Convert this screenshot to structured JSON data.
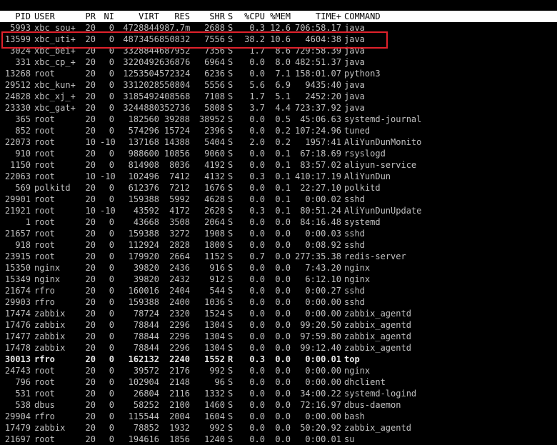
{
  "header": {
    "pid": "PID",
    "user": "USER",
    "pr": "PR",
    "ni": "NI",
    "virt": "VIRT",
    "res": "RES",
    "shr": "SHR",
    "s": "S",
    "cpu": "%CPU",
    "mem": "%MEM",
    "time": "TIME+",
    "command": "COMMAND"
  },
  "highlight_color": "#e0212b",
  "processes": [
    {
      "pid": "5993",
      "user": "xbc_sou+",
      "pr": "20",
      "ni": "0",
      "virt": "4728844",
      "res": "987.7m",
      "shr": "2688",
      "s": "S",
      "cpu": "0.3",
      "mem": "12.6",
      "time": "706:58.17",
      "command": "java"
    },
    {
      "pid": "13599",
      "user": "xbc_uti+",
      "pr": "20",
      "ni": "0",
      "virt": "4873456",
      "res": "850832",
      "shr": "7556",
      "s": "S",
      "cpu": "38.2",
      "mem": "10.6",
      "time": "4604:38",
      "command": "java",
      "highlighted": true
    },
    {
      "pid": "3024",
      "user": "xbc_bei+",
      "pr": "20",
      "ni": "0",
      "virt": "3328844",
      "res": "687952",
      "shr": "7356",
      "s": "S",
      "cpu": "1.7",
      "mem": "8.6",
      "time": "729:58.39",
      "command": "java"
    },
    {
      "pid": "331",
      "user": "xbc_cp_+",
      "pr": "20",
      "ni": "0",
      "virt": "3220492",
      "res": "636876",
      "shr": "6964",
      "s": "S",
      "cpu": "0.0",
      "mem": "8.0",
      "time": "482:51.37",
      "command": "java"
    },
    {
      "pid": "13268",
      "user": "root",
      "pr": "20",
      "ni": "0",
      "virt": "1253504",
      "res": "572324",
      "shr": "6236",
      "s": "S",
      "cpu": "0.0",
      "mem": "7.1",
      "time": "158:01.07",
      "command": "python3"
    },
    {
      "pid": "29512",
      "user": "xbc_kun+",
      "pr": "20",
      "ni": "0",
      "virt": "3312028",
      "res": "550804",
      "shr": "5556",
      "s": "S",
      "cpu": "5.6",
      "mem": "6.9",
      "time": "9435:40",
      "command": "java"
    },
    {
      "pid": "24828",
      "user": "xbc_xj_+",
      "pr": "20",
      "ni": "0",
      "virt": "3185492",
      "res": "408568",
      "shr": "7108",
      "s": "S",
      "cpu": "1.7",
      "mem": "5.1",
      "time": "2452:20",
      "command": "java"
    },
    {
      "pid": "23330",
      "user": "xbc_gat+",
      "pr": "20",
      "ni": "0",
      "virt": "3244880",
      "res": "352736",
      "shr": "5808",
      "s": "S",
      "cpu": "3.7",
      "mem": "4.4",
      "time": "723:37.92",
      "command": "java"
    },
    {
      "pid": "365",
      "user": "root",
      "pr": "20",
      "ni": "0",
      "virt": "182560",
      "res": "39288",
      "shr": "38952",
      "s": "S",
      "cpu": "0.0",
      "mem": "0.5",
      "time": "45:06.63",
      "command": "systemd-journal"
    },
    {
      "pid": "852",
      "user": "root",
      "pr": "20",
      "ni": "0",
      "virt": "574296",
      "res": "15724",
      "shr": "2396",
      "s": "S",
      "cpu": "0.0",
      "mem": "0.2",
      "time": "107:24.96",
      "command": "tuned"
    },
    {
      "pid": "22073",
      "user": "root",
      "pr": "10",
      "ni": "-10",
      "virt": "137168",
      "res": "14388",
      "shr": "5404",
      "s": "S",
      "cpu": "2.0",
      "mem": "0.2",
      "time": "1957:41",
      "command": "AliYunDunMonito"
    },
    {
      "pid": "910",
      "user": "root",
      "pr": "20",
      "ni": "0",
      "virt": "988600",
      "res": "10856",
      "shr": "9060",
      "s": "S",
      "cpu": "0.0",
      "mem": "0.1",
      "time": "67:18.69",
      "command": "rsyslogd"
    },
    {
      "pid": "1150",
      "user": "root",
      "pr": "20",
      "ni": "0",
      "virt": "814908",
      "res": "8036",
      "shr": "4192",
      "s": "S",
      "cpu": "0.0",
      "mem": "0.1",
      "time": "83:57.02",
      "command": "aliyun-service"
    },
    {
      "pid": "22063",
      "user": "root",
      "pr": "10",
      "ni": "-10",
      "virt": "102496",
      "res": "7412",
      "shr": "4132",
      "s": "S",
      "cpu": "0.3",
      "mem": "0.1",
      "time": "410:17.19",
      "command": "AliYunDun"
    },
    {
      "pid": "569",
      "user": "polkitd",
      "pr": "20",
      "ni": "0",
      "virt": "612376",
      "res": "7212",
      "shr": "1676",
      "s": "S",
      "cpu": "0.0",
      "mem": "0.1",
      "time": "22:27.10",
      "command": "polkitd"
    },
    {
      "pid": "29901",
      "user": "root",
      "pr": "20",
      "ni": "0",
      "virt": "159388",
      "res": "5992",
      "shr": "4628",
      "s": "S",
      "cpu": "0.0",
      "mem": "0.1",
      "time": "0:00.02",
      "command": "sshd"
    },
    {
      "pid": "21921",
      "user": "root",
      "pr": "10",
      "ni": "-10",
      "virt": "43592",
      "res": "4172",
      "shr": "2628",
      "s": "S",
      "cpu": "0.3",
      "mem": "0.1",
      "time": "80:51.24",
      "command": "AliYunDunUpdate"
    },
    {
      "pid": "1",
      "user": "root",
      "pr": "20",
      "ni": "0",
      "virt": "43668",
      "res": "3508",
      "shr": "2064",
      "s": "S",
      "cpu": "0.0",
      "mem": "0.0",
      "time": "84:16.48",
      "command": "systemd"
    },
    {
      "pid": "21657",
      "user": "root",
      "pr": "20",
      "ni": "0",
      "virt": "159388",
      "res": "3272",
      "shr": "1908",
      "s": "S",
      "cpu": "0.0",
      "mem": "0.0",
      "time": "0:00.03",
      "command": "sshd"
    },
    {
      "pid": "918",
      "user": "root",
      "pr": "20",
      "ni": "0",
      "virt": "112924",
      "res": "2828",
      "shr": "1800",
      "s": "S",
      "cpu": "0.0",
      "mem": "0.0",
      "time": "0:08.92",
      "command": "sshd"
    },
    {
      "pid": "23915",
      "user": "root",
      "pr": "20",
      "ni": "0",
      "virt": "179920",
      "res": "2664",
      "shr": "1152",
      "s": "S",
      "cpu": "0.7",
      "mem": "0.0",
      "time": "277:35.38",
      "command": "redis-server"
    },
    {
      "pid": "15350",
      "user": "nginx",
      "pr": "20",
      "ni": "0",
      "virt": "39820",
      "res": "2436",
      "shr": "916",
      "s": "S",
      "cpu": "0.0",
      "mem": "0.0",
      "time": "7:43.20",
      "command": "nginx"
    },
    {
      "pid": "15349",
      "user": "nginx",
      "pr": "20",
      "ni": "0",
      "virt": "39820",
      "res": "2432",
      "shr": "912",
      "s": "S",
      "cpu": "0.0",
      "mem": "0.0",
      "time": "6:12.10",
      "command": "nginx"
    },
    {
      "pid": "21674",
      "user": "rfro",
      "pr": "20",
      "ni": "0",
      "virt": "160016",
      "res": "2404",
      "shr": "544",
      "s": "S",
      "cpu": "0.0",
      "mem": "0.0",
      "time": "0:00.27",
      "command": "sshd"
    },
    {
      "pid": "29903",
      "user": "rfro",
      "pr": "20",
      "ni": "0",
      "virt": "159388",
      "res": "2400",
      "shr": "1036",
      "s": "S",
      "cpu": "0.0",
      "mem": "0.0",
      "time": "0:00.00",
      "command": "sshd"
    },
    {
      "pid": "17474",
      "user": "zabbix",
      "pr": "20",
      "ni": "0",
      "virt": "78724",
      "res": "2320",
      "shr": "1524",
      "s": "S",
      "cpu": "0.0",
      "mem": "0.0",
      "time": "0:00.00",
      "command": "zabbix_agentd"
    },
    {
      "pid": "17476",
      "user": "zabbix",
      "pr": "20",
      "ni": "0",
      "virt": "78844",
      "res": "2296",
      "shr": "1304",
      "s": "S",
      "cpu": "0.0",
      "mem": "0.0",
      "time": "99:20.50",
      "command": "zabbix_agentd"
    },
    {
      "pid": "17477",
      "user": "zabbix",
      "pr": "20",
      "ni": "0",
      "virt": "78844",
      "res": "2296",
      "shr": "1304",
      "s": "S",
      "cpu": "0.0",
      "mem": "0.0",
      "time": "97:59.80",
      "command": "zabbix_agentd"
    },
    {
      "pid": "17478",
      "user": "zabbix",
      "pr": "20",
      "ni": "0",
      "virt": "78844",
      "res": "2296",
      "shr": "1304",
      "s": "S",
      "cpu": "0.0",
      "mem": "0.0",
      "time": "99:12.40",
      "command": "zabbix_agentd"
    },
    {
      "pid": "30013",
      "user": "rfro",
      "pr": "20",
      "ni": "0",
      "virt": "162132",
      "res": "2240",
      "shr": "1552",
      "s": "R",
      "cpu": "0.3",
      "mem": "0.0",
      "time": "0:00.01",
      "command": "top",
      "bold": true
    },
    {
      "pid": "24743",
      "user": "root",
      "pr": "20",
      "ni": "0",
      "virt": "39572",
      "res": "2176",
      "shr": "992",
      "s": "S",
      "cpu": "0.0",
      "mem": "0.0",
      "time": "0:00.00",
      "command": "nginx"
    },
    {
      "pid": "796",
      "user": "root",
      "pr": "20",
      "ni": "0",
      "virt": "102904",
      "res": "2148",
      "shr": "96",
      "s": "S",
      "cpu": "0.0",
      "mem": "0.0",
      "time": "0:00.00",
      "command": "dhclient"
    },
    {
      "pid": "531",
      "user": "root",
      "pr": "20",
      "ni": "0",
      "virt": "26804",
      "res": "2116",
      "shr": "1332",
      "s": "S",
      "cpu": "0.0",
      "mem": "0.0",
      "time": "34:00.22",
      "command": "systemd-logind"
    },
    {
      "pid": "538",
      "user": "dbus",
      "pr": "20",
      "ni": "0",
      "virt": "58252",
      "res": "2100",
      "shr": "1460",
      "s": "S",
      "cpu": "0.0",
      "mem": "0.0",
      "time": "72:16.97",
      "command": "dbus-daemon"
    },
    {
      "pid": "29904",
      "user": "rfro",
      "pr": "20",
      "ni": "0",
      "virt": "115544",
      "res": "2004",
      "shr": "1604",
      "s": "S",
      "cpu": "0.0",
      "mem": "0.0",
      "time": "0:00.00",
      "command": "bash"
    },
    {
      "pid": "17479",
      "user": "zabbix",
      "pr": "20",
      "ni": "0",
      "virt": "78852",
      "res": "1932",
      "shr": "992",
      "s": "S",
      "cpu": "0.0",
      "mem": "0.0",
      "time": "50:20.92",
      "command": "zabbix_agentd"
    },
    {
      "pid": "21697",
      "user": "root",
      "pr": "20",
      "ni": "0",
      "virt": "194616",
      "res": "1856",
      "shr": "1240",
      "s": "S",
      "cpu": "0.0",
      "mem": "0.0",
      "time": "0:00.01",
      "command": "su"
    }
  ]
}
